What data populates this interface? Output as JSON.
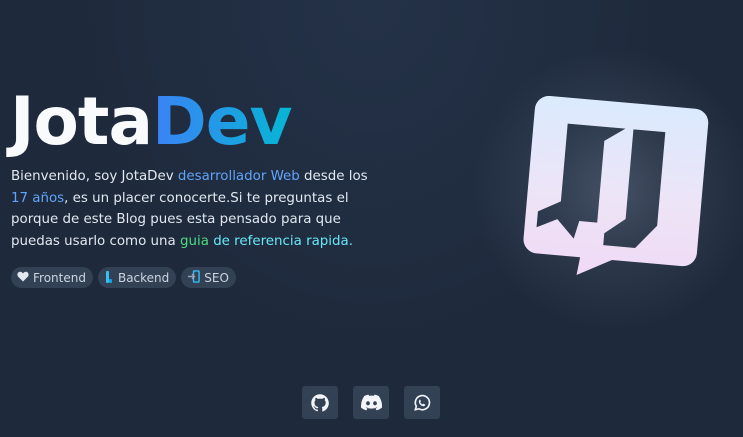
{
  "hero": {
    "title_main": "Jota",
    "title_accent": "Dev"
  },
  "intro": {
    "p1": "Bienvenido, soy JotaDev ",
    "link1": "desarrollador Web",
    "p2": " desde los ",
    "link2": "17 años",
    "p3": ", es un placer conocerte.Si te preguntas el porque de este Blog pues esta pensado para que puedas usarlo como una ",
    "link3": "guia",
    "p4": " ",
    "link4": "de referencia rapida.",
    "colors": {
      "blue": "#60a5fa",
      "green": "#4ade80",
      "cyan": "#67e8f9"
    }
  },
  "tags": [
    {
      "label": "Frontend",
      "icon": "heart-icon"
    },
    {
      "label": "Backend",
      "icon": "bar-icon"
    },
    {
      "label": "SEO",
      "icon": "login-arrow-icon"
    }
  ],
  "socials": [
    {
      "icon": "github-icon"
    },
    {
      "icon": "discord-icon"
    },
    {
      "icon": "whatsapp-icon"
    }
  ],
  "colors": {
    "background": "#1e293b",
    "accent_start": "#3b82f6",
    "accent_end": "#06b6d4",
    "tag_bg": "#334155"
  }
}
